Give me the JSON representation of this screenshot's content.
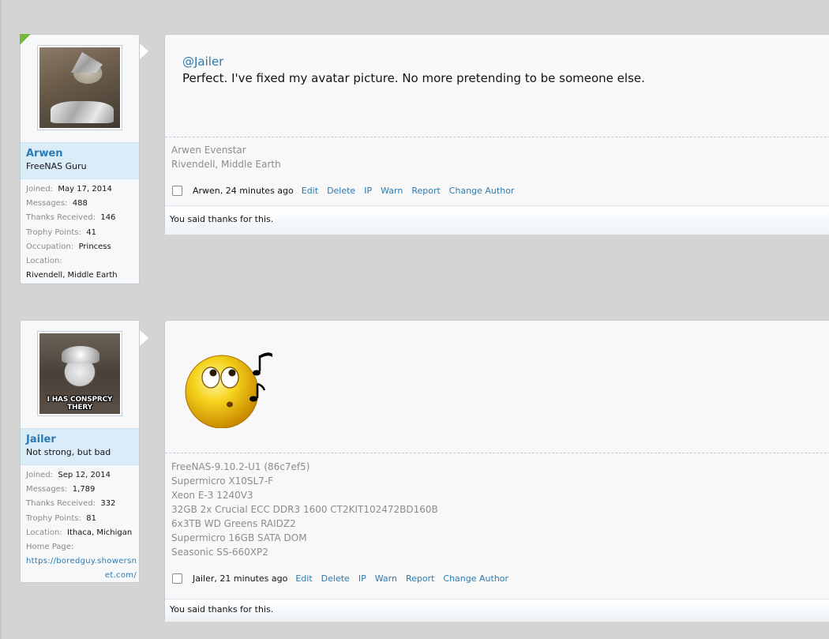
{
  "posts": [
    {
      "user": {
        "name": "Arwen",
        "title": "FreeNAS Guru",
        "stats": [
          {
            "label": "Joined:",
            "value": "May 17, 2014"
          },
          {
            "label": "Messages:",
            "value": "488"
          },
          {
            "label": "Thanks Received:",
            "value": "146"
          },
          {
            "label": "Trophy Points:",
            "value": "41"
          },
          {
            "label": "Occupation:",
            "value": "Princess"
          },
          {
            "label": "Location:",
            "value": "Rivendell, Middle Earth"
          }
        ]
      },
      "message": {
        "mention": "@Jailer",
        "text": "Perfect. I've fixed my avatar picture. No more pretending to be someone else."
      },
      "signature": [
        "Arwen Evenstar",
        "Rivendell, Middle Earth"
      ],
      "meta": {
        "author_time": "Arwen, 24 minutes ago"
      },
      "thanks": "You said thanks for this."
    },
    {
      "user": {
        "name": "Jailer",
        "title": "Not strong, but bad",
        "avatar_caption": "I HAS CONSPRCY THERY",
        "stats": [
          {
            "label": "Joined:",
            "value": "Sep 12, 2014"
          },
          {
            "label": "Messages:",
            "value": "1,789"
          },
          {
            "label": "Thanks Received:",
            "value": "332"
          },
          {
            "label": "Trophy Points:",
            "value": "81"
          },
          {
            "label": "Location:",
            "value": "Ithaca, Michigan"
          },
          {
            "label": "Home Page:",
            "value_line1": "https://boredguy.showersn",
            "value_line2": "et.com/"
          }
        ]
      },
      "message": {
        "image": "whistling-smiley-icon"
      },
      "signature": [
        "FreeNAS-9.10.2-U1 (86c7ef5)",
        "Supermicro X10SL7-F",
        "Xeon E-3 1240V3",
        "32GB 2x Crucial ECC DDR3 1600 CT2KIT102472BD160B",
        "6x3TB WD Greens RAIDZ2",
        "Supermicro 16GB SATA DOM",
        "Seasonic SS-660XP2"
      ],
      "meta": {
        "author_time": "Jailer, 21 minutes ago"
      },
      "thanks": "You said thanks for this."
    }
  ],
  "controls": {
    "edit": "Edit",
    "delete": "Delete",
    "ip": "IP",
    "warn": "Warn",
    "report": "Report",
    "change_author": "Change Author"
  },
  "colors": {
    "link": "#2b7ab0",
    "name_block_bg": "#dbecf9",
    "online_corner": "#71b839"
  }
}
